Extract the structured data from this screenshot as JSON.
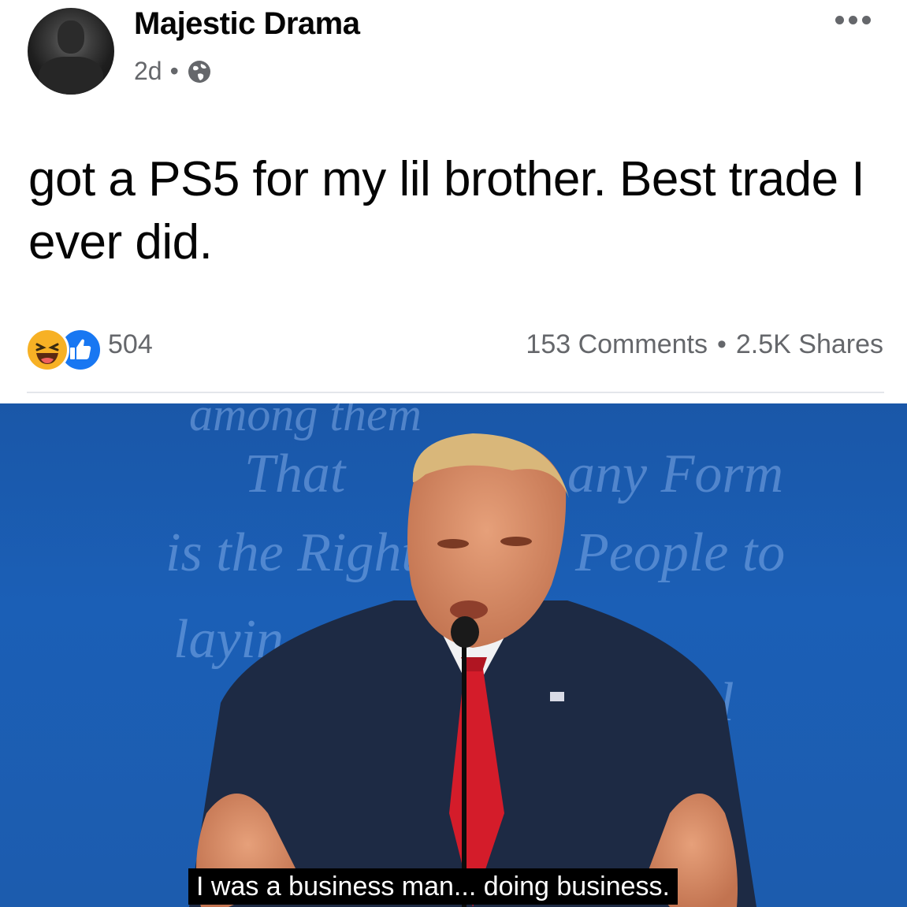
{
  "post": {
    "author": "Majestic Drama",
    "time": "2d",
    "separator": "•",
    "privacy_icon": "globe-icon",
    "more_icon": "more-options-icon",
    "text": "got a PS5 for my lil brother. Best trade I ever did."
  },
  "reactions": {
    "types": [
      "haha-reaction-icon",
      "like-reaction-icon"
    ],
    "count": "504",
    "comments": "153 Comments",
    "separator": "•",
    "shares": "2.5K Shares"
  },
  "media": {
    "caption": "I was a business man... doing business."
  },
  "colors": {
    "secondary_text": "#65676b",
    "like_blue": "#1877f2",
    "haha_yellow": "#f7b125",
    "background_blue": "#1b5fb6",
    "tie_red": "#d41c2a"
  }
}
